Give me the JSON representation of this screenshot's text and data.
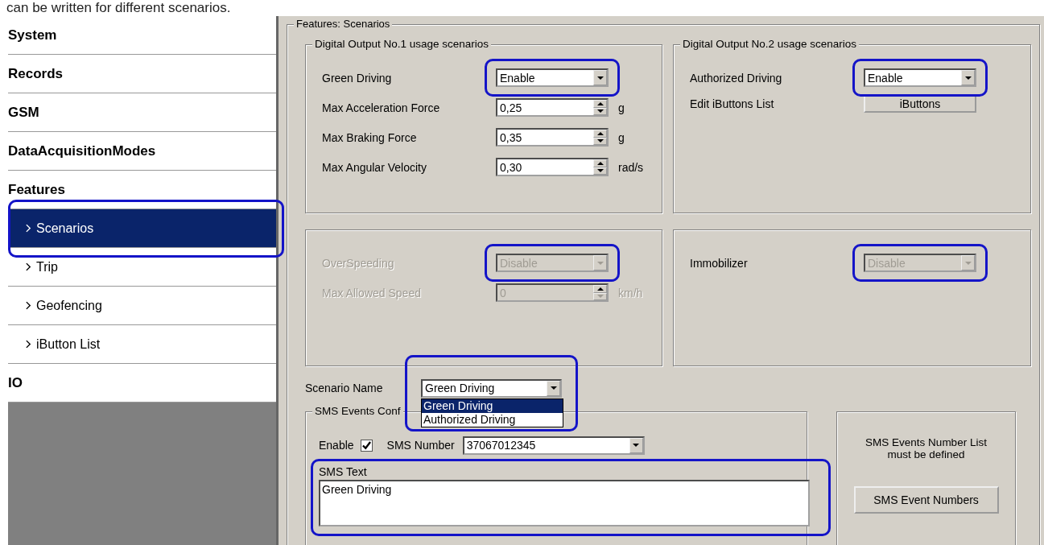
{
  "doc_text": "can be written for different scenarios.",
  "sidebar": {
    "items": [
      {
        "label": "System",
        "kind": "section",
        "selected": false,
        "highlighted": false
      },
      {
        "label": "Records",
        "kind": "section",
        "selected": false,
        "highlighted": false
      },
      {
        "label": "GSM",
        "kind": "section",
        "selected": false,
        "highlighted": false
      },
      {
        "label": "DataAcquisitionModes",
        "kind": "section",
        "selected": false,
        "highlighted": false
      },
      {
        "label": "Features",
        "kind": "section",
        "selected": false,
        "highlighted": false
      },
      {
        "label": "Scenarios",
        "kind": "subitem",
        "selected": true,
        "highlighted": true
      },
      {
        "label": "Trip",
        "kind": "subitem",
        "selected": false,
        "highlighted": false
      },
      {
        "label": "Geofencing",
        "kind": "subitem",
        "selected": false,
        "highlighted": false
      },
      {
        "label": "iButton List",
        "kind": "subitem",
        "selected": false,
        "highlighted": false
      },
      {
        "label": "IO",
        "kind": "section",
        "selected": false,
        "highlighted": false
      }
    ]
  },
  "panel": {
    "title": "Features: Scenarios",
    "groups": [
      {
        "title": "Digital Output No.1 usage scenarios",
        "disabled": false,
        "scenario": {
          "label": "Green Driving",
          "value": "Enable",
          "disabled": false,
          "highlighted": true
        },
        "params": [
          {
            "label": "Max Acceleration Force",
            "value": "0,25",
            "unit": "g"
          },
          {
            "label": "Max Braking Force",
            "value": "0,35",
            "unit": "g"
          },
          {
            "label": "Max Angular Velocity",
            "value": "0,30",
            "unit": "rad/s"
          }
        ]
      },
      {
        "title": "Digital Output No.2 usage scenarios",
        "disabled": false,
        "scenario": {
          "label": "Authorized Driving",
          "value": "Enable",
          "disabled": false,
          "highlighted": true
        },
        "edit_list": {
          "label": "Edit iButtons List",
          "button": "iButtons"
        }
      },
      {
        "disabled": true,
        "scenario": {
          "label": "OverSpeeding",
          "value": "Disable",
          "disabled": true,
          "highlighted": true
        },
        "params": [
          {
            "label": "Max Allowed Speed",
            "value": "0",
            "unit": "km/h"
          }
        ]
      },
      {
        "disabled": false,
        "scenario": {
          "label": "Immobilizer",
          "value": "Disable",
          "disabled": true,
          "highlighted": true
        }
      }
    ],
    "scenario_name": {
      "label": "Scenario Name",
      "value": "Green Driving",
      "expanded": true,
      "highlighted": true,
      "options": [
        {
          "label": "Green Driving",
          "selected": true
        },
        {
          "label": "Authorized Driving",
          "selected": false
        }
      ]
    },
    "sms_config": {
      "title": "SMS Events Conf",
      "enable": {
        "label": "Enable",
        "checked": true
      },
      "sms_number": {
        "label": "SMS Number",
        "value": "37067012345"
      },
      "sms_text": {
        "label": "SMS Text",
        "value": "Green Driving",
        "highlighted": true
      }
    },
    "sms_numbers": {
      "note": "SMS Events Number List must be defined",
      "button": "SMS Event Numbers"
    }
  }
}
